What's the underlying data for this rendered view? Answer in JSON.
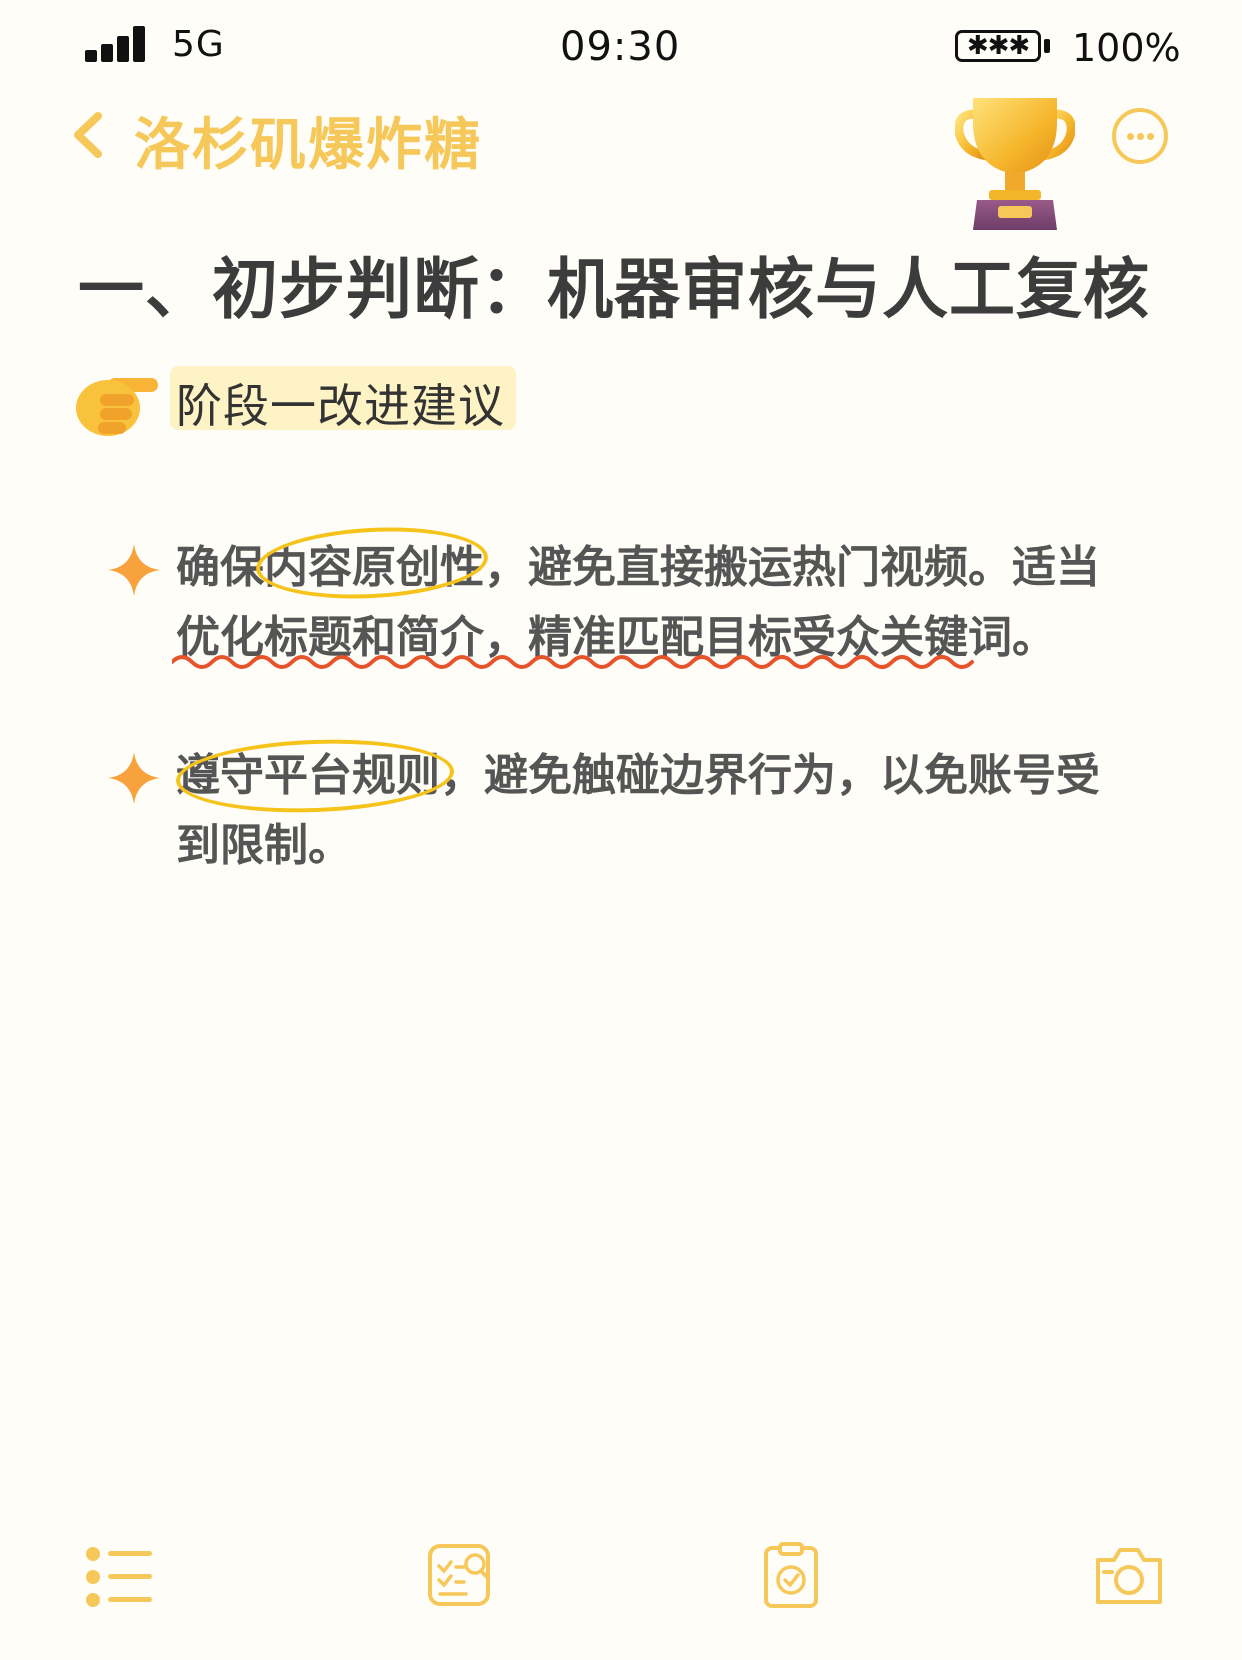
{
  "status_bar": {
    "network": "5G",
    "time": "09:30",
    "battery_glyphs": "✱✱✱",
    "battery_percent": "100%"
  },
  "header": {
    "title": "洛杉矶爆炸糖",
    "back_icon": "chevron-left-icon",
    "decoration_icon": "trophy-icon",
    "more_icon": "more-horizontal-icon"
  },
  "heading": "一、初步判断：机器审核与人工复核",
  "subheading": {
    "icon": "pointing-hand-icon",
    "text": "阶段一改进建议"
  },
  "bullets": [
    {
      "icon": "sparkle-icon",
      "lines": [
        "确保内容原创性，避免直接搬运热门视频。适当",
        "优化标题和简介，精准匹配目标受众关键词。"
      ]
    },
    {
      "icon": "sparkle-icon",
      "lines": [
        "遵守平台规则，避免触碰边界行为，以免账号受",
        "到限制。"
      ]
    }
  ],
  "toolbar": {
    "items": [
      "list-icon",
      "search-checklist-icon",
      "clipboard-check-icon",
      "camera-icon"
    ]
  },
  "colors": {
    "accent": "#f6c85a",
    "highlight": "#fdf3c4",
    "circle": "#f6c31a",
    "wavy": "#e8542a",
    "sparkle": "#f7a23c",
    "background": "#fefdf8"
  }
}
